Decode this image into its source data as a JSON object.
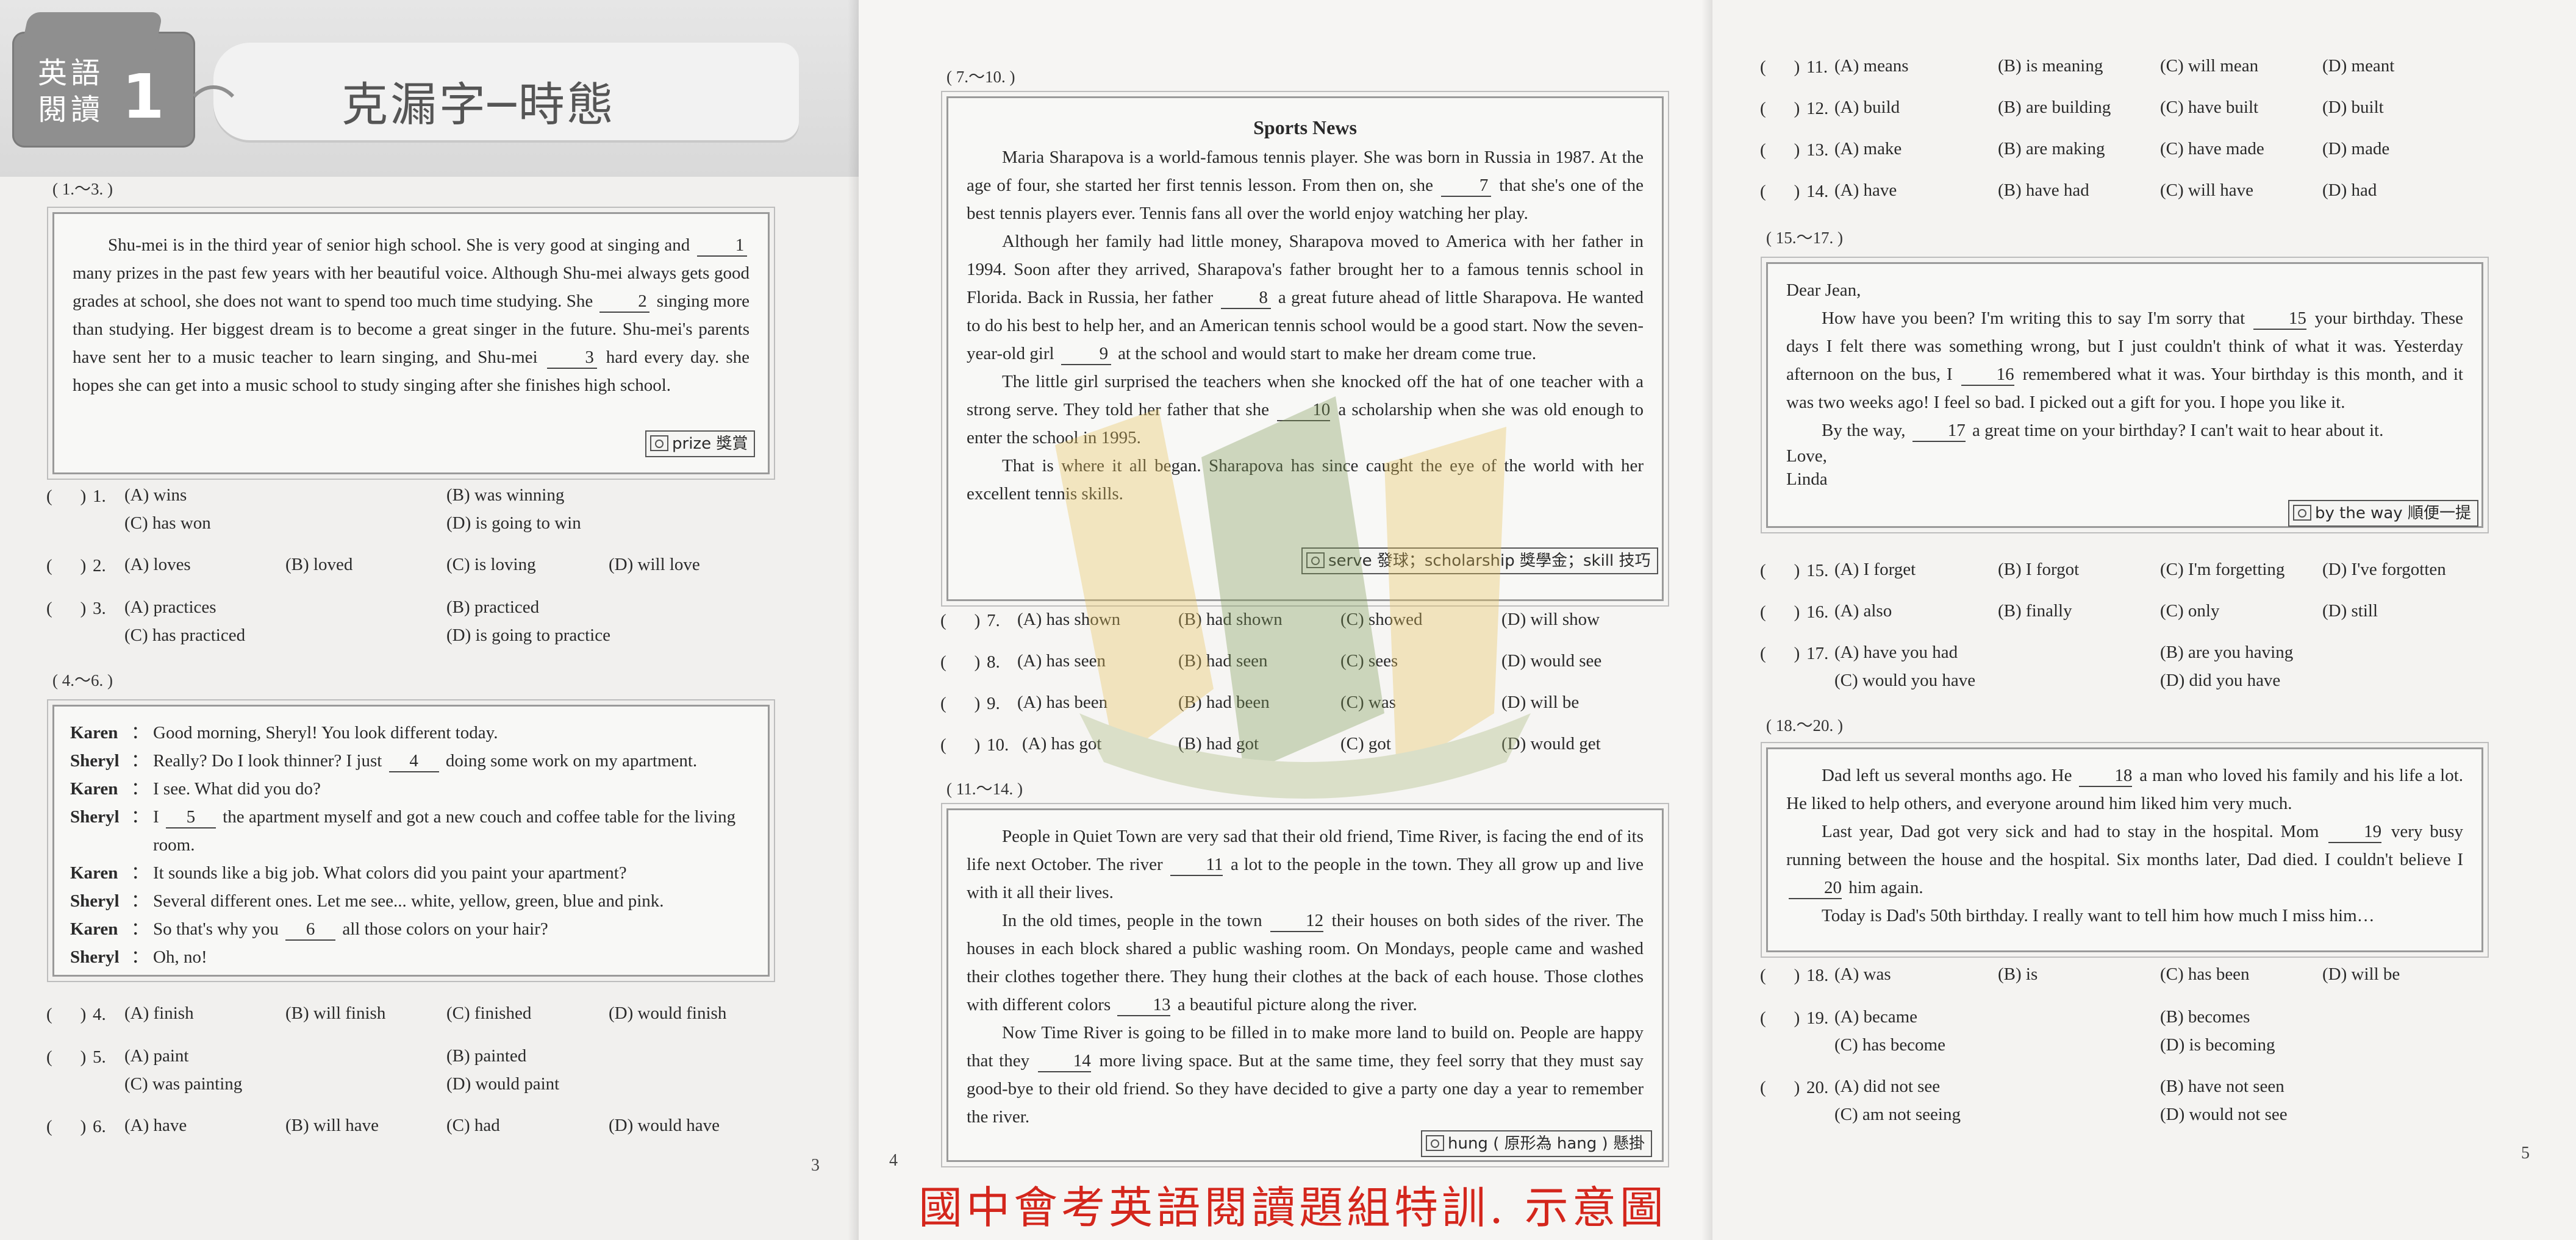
{
  "header": {
    "badge_line1": "英語",
    "badge_line2": "閱讀",
    "badge_num": "1",
    "title": "克漏字─時態"
  },
  "set1": {
    "range": "( 1.～3. )",
    "passage": [
      [
        "Shu-mei is in the third year of senior high school.  She is very good at singing and ",
        "1",
        " many prizes in the past few years with her beautiful voice.  Although Shu-mei always gets good grades at school, she does not want to spend too much time studying.  She ",
        "2",
        " singing more than studying.  Her biggest dream is to become a great singer in the future.  Shu-mei's parents have sent her to a music teacher to learn singing, and Shu-mei ",
        "3",
        " hard every day.  she hopes she can get into a music school to study singing after she finishes high school."
      ]
    ],
    "vocab": "prize 獎賞"
  },
  "q1": {
    "num": "1.",
    "a": "(A) wins",
    "b": "(B) was winning",
    "c": "(C) has won",
    "d": "(D) is going to win"
  },
  "q2": {
    "num": "2.",
    "a": "(A) loves",
    "b": "(B) loved",
    "c": "(C) is loving",
    "d": "(D) will love"
  },
  "q3": {
    "num": "3.",
    "a": "(A) practices",
    "b": "(B) practiced",
    "c": "(C) has practiced",
    "d": "(D) is going to practice"
  },
  "set2": {
    "range": "( 4.～6. )",
    "dialog": [
      {
        "speaker": "Karen",
        "pre": "Good morning, Sheryl!  You look different today.",
        "blank": "",
        "post": ""
      },
      {
        "speaker": "Sheryl",
        "pre": "Really?  Do I look thinner?  I just ",
        "blank": "4",
        "post": " doing some work on my apartment."
      },
      {
        "speaker": "Karen",
        "pre": "I see.  What did you do?",
        "blank": "",
        "post": ""
      },
      {
        "speaker": "Sheryl",
        "pre": "I ",
        "blank": "5",
        "post": " the apartment myself and got a new couch and coffee table for the living room."
      },
      {
        "speaker": "Karen",
        "pre": "It sounds like a big job.  What colors did you paint your apartment?",
        "blank": "",
        "post": ""
      },
      {
        "speaker": "Sheryl",
        "pre": "Several different ones.  Let me see... white, yellow, green, blue and pink.",
        "blank": "",
        "post": ""
      },
      {
        "speaker": "Karen",
        "pre": "So that's why you ",
        "blank": "6",
        "post": " all those colors on your hair?"
      },
      {
        "speaker": "Sheryl",
        "pre": "Oh, no!",
        "blank": "",
        "post": ""
      }
    ],
    "colon": "："
  },
  "q4": {
    "num": "4.",
    "a": "(A) finish",
    "b": "(B) will finish",
    "c": "(C) finished",
    "d": "(D) would finish"
  },
  "q5": {
    "num": "5.",
    "a": "(A) paint",
    "b": "(B) painted",
    "c": "(C) was painting",
    "d": "(D) would paint"
  },
  "q6": {
    "num": "6.",
    "a": "(A) have",
    "b": "(B) will have",
    "c": "(C) had",
    "d": "(D) would have"
  },
  "set3": {
    "range": "( 7.～10. )",
    "title": "Sports News",
    "p1a": "Maria Sharapova is a world-famous tennis player.  She was born in Russia in 1987.  At the age of four, she started her first tennis lesson.  From then on, she ",
    "b7": "7",
    "p1b": " that she's one of the best tennis players ever.  Tennis fans all over the world enjoy watching her play.",
    "p2a": "Although her family had little money, Sharapova moved to America with her father in 1994.  Soon after they arrived, Sharapova's father brought her to a famous tennis school in Florida.  Back in Russia, her father ",
    "b8": "8",
    "p2b": " a great future ahead of little Sharapova.  He wanted to do his best to help her, and an American tennis school would be a good start.  Now the seven-year-old girl ",
    "b9": "9",
    "p2c": " at the school and would start to make her dream come true.",
    "p3a": "The little girl surprised the teachers when she knocked off the hat of one teacher with a strong serve.  They told her father that she ",
    "b10": "10",
    "p3b": " a scholarship when she was old enough to enter the school in 1995.",
    "p4": "That is where it all began.  Sharapova has since caught the eye of the world with her excellent tennis skills.",
    "vocab": "serve 發球；scholarship 獎學金；skill 技巧"
  },
  "q7": {
    "num": "7.",
    "a": "(A) has shown",
    "b": "(B) had shown",
    "c": "(C) showed",
    "d": "(D) will show"
  },
  "q8": {
    "num": "8.",
    "a": "(A) has seen",
    "b": "(B) had seen",
    "c": "(C) sees",
    "d": "(D) would see"
  },
  "q9": {
    "num": "9.",
    "a": "(A) has been",
    "b": "(B) had been",
    "c": "(C) was",
    "d": "(D) will be"
  },
  "q10": {
    "num": "10.",
    "a": "(A) has got",
    "b": "(B) had got",
    "c": "(C) got",
    "d": "(D) would get"
  },
  "set4": {
    "range": "( 11.～14. )",
    "p1a": "People in Quiet Town are very sad that their old friend, Time River, is facing the end of its life next October.  The river ",
    "b11": "11",
    "p1b": " a lot to the people in the town.  They all grow up and live with it all their lives.",
    "p2a": "In the old times, people in the town ",
    "b12": "12",
    "p2b": " their houses on both sides of the river.  The houses in each block shared a public washing room.  On Mondays, people came and washed their clothes together there.  They hung their clothes at the back of each house.  Those clothes with different colors ",
    "b13": "13",
    "p2c": " a beautiful picture along the river.",
    "p3a": "Now Time River is going to be filled in to make more land to build on.  People are happy that they ",
    "b14": "14",
    "p3b": " more living space.  But at the same time, they feel sorry that they must say good-bye to their old friend.  So they have decided to give a party one day a year to remember the river.",
    "vocab": "hung ( 原形為 hang ) 懸掛"
  },
  "q11": {
    "num": "11.",
    "a": "(A) means",
    "b": "(B) is meaning",
    "c": "(C) will mean",
    "d": "(D) meant"
  },
  "q12": {
    "num": "12.",
    "a": "(A) build",
    "b": "(B) are building",
    "c": "(C) have built",
    "d": "(D) built"
  },
  "q13": {
    "num": "13.",
    "a": "(A) make",
    "b": "(B) are making",
    "c": "(C) have made",
    "d": "(D) made"
  },
  "q14": {
    "num": "14.",
    "a": "(A) have",
    "b": "(B) have had",
    "c": "(C) will have",
    "d": "(D) had"
  },
  "set5": {
    "range": "( 15.～17. )",
    "greeting": "Dear Jean,",
    "p1a": "How have you been?  I'm writing this to say I'm sorry that ",
    "b15": "15",
    "p1b": " your birthday.  These days I felt there was something wrong, but I just couldn't think of what it was.  Yesterday afternoon on the bus, I ",
    "b16": "16",
    "p1c": " remembered what it was.  Your birthday is this month, and it was two weeks ago!  I feel so bad.  I picked out a gift for you.  I hope you like it.",
    "p2a": "By the way, ",
    "b17": "17",
    "p2b": " a great time on your birthday?  I can't wait to hear about it.",
    "closing": "Love,",
    "signature": "Linda",
    "vocab": "by the way 順便一提"
  },
  "q15": {
    "num": "15.",
    "a": "(A) I forget",
    "b": "(B) I forgot",
    "c": "(C) I'm forgetting",
    "d": "(D) I've forgotten"
  },
  "q16": {
    "num": "16.",
    "a": "(A) also",
    "b": "(B) finally",
    "c": "(C) only",
    "d": "(D) still"
  },
  "q17": {
    "num": "17.",
    "a": "(A) have you had",
    "b": "(B) are you having",
    "c": "(C) would you have",
    "d": "(D) did you have"
  },
  "set6": {
    "range": "( 18.～20. )",
    "p1a": "Dad left us several months ago.  He ",
    "b18": "18",
    "p1b": " a man who loved his family and his life a lot.  He liked to help others, and everyone around him liked him very much.",
    "p2a": "Last year, Dad got very sick and had to stay in the hospital.  Mom ",
    "b19": "19",
    "p2b": " very busy running between the house and the hospital.  Six months later, Dad died.  I couldn't believe I ",
    "b20": "20",
    "p2c": " him again.",
    "p3": "Today is Dad's 50th birthday.  I really want to tell him how much I miss him…"
  },
  "q18": {
    "num": "18.",
    "a": "(A) was",
    "b": "(B) is",
    "c": "(C) has been",
    "d": "(D) will be"
  },
  "q19": {
    "num": "19.",
    "a": "(A) became",
    "b": "(B) becomes",
    "c": "(C) has become",
    "d": "(D) is becoming"
  },
  "q20": {
    "num": "20.",
    "a": "(A) did not see",
    "b": "(B) have not seen",
    "c": "(C) am not seeing",
    "d": "(D) would not see"
  },
  "pages": {
    "p3": "3",
    "p4": "4",
    "p5": "5"
  },
  "paren_open": "(",
  "paren_close": ")",
  "caption": "國中會考英語閱讀題組特訓. 示意圖"
}
